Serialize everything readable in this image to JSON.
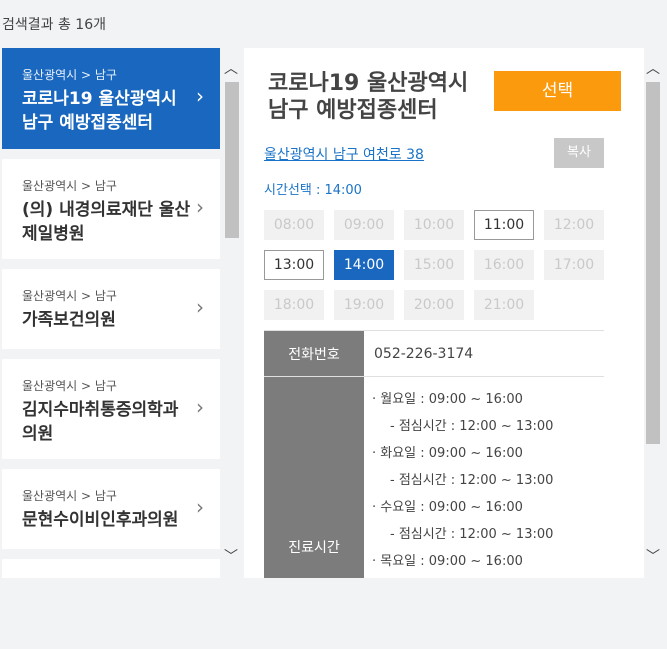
{
  "result_count": "검색결과 총 16개",
  "list": [
    {
      "region": "울산광역시 > 남구",
      "name": "코로나19 울산광역시 남구 예방접종센터",
      "active": true
    },
    {
      "region": "울산광역시 > 남구",
      "name": "(의) 내경의료재단 울산제일병원",
      "active": false
    },
    {
      "region": "울산광역시 > 남구",
      "name": "가족보건의원",
      "active": false
    },
    {
      "region": "울산광역시 > 남구",
      "name": "김지수마취통증의학과의원",
      "active": false
    },
    {
      "region": "울산광역시 > 남구",
      "name": "문현수이비인후과의원",
      "active": false
    }
  ],
  "detail": {
    "title": "코로나19 울산광역시 남구 예방접종센터",
    "select_label": "선택",
    "address": "울산광역시 남구 여천로 38",
    "copy_label": "복사",
    "time_selection": "시간선택 : 14:00",
    "slots": [
      {
        "time": "08:00",
        "state": "disabled"
      },
      {
        "time": "09:00",
        "state": "disabled"
      },
      {
        "time": "10:00",
        "state": "disabled"
      },
      {
        "time": "11:00",
        "state": "available"
      },
      {
        "time": "12:00",
        "state": "disabled"
      },
      {
        "time": "13:00",
        "state": "available"
      },
      {
        "time": "14:00",
        "state": "selected"
      },
      {
        "time": "15:00",
        "state": "disabled"
      },
      {
        "time": "16:00",
        "state": "disabled"
      },
      {
        "time": "17:00",
        "state": "disabled"
      },
      {
        "time": "18:00",
        "state": "disabled"
      },
      {
        "time": "19:00",
        "state": "disabled"
      },
      {
        "time": "20:00",
        "state": "disabled"
      },
      {
        "time": "21:00",
        "state": "disabled"
      }
    ],
    "phone_label": "전화번호",
    "phone": "052-226-3174",
    "hours_label": "진료시간",
    "hours": [
      {
        "text": "· 월요일 : 09:00 ~ 16:00",
        "sub": false
      },
      {
        "text": "- 점심시간 : 12:00 ~ 13:00",
        "sub": true
      },
      {
        "text": "· 화요일 : 09:00 ~ 16:00",
        "sub": false
      },
      {
        "text": "- 점심시간 : 12:00 ~ 13:00",
        "sub": true
      },
      {
        "text": "· 수요일 : 09:00 ~ 16:00",
        "sub": false
      },
      {
        "text": "- 점심시간 : 12:00 ~ 13:00",
        "sub": true
      },
      {
        "text": "· 목요일 : 09:00 ~ 16:00",
        "sub": false
      }
    ]
  },
  "icons": {
    "chevron_right": "›",
    "scroll_up": "︿",
    "scroll_down": "﹀"
  },
  "colors": {
    "accent_blue": "#1967be",
    "select_orange": "#fc9a0e",
    "label_gray": "#7c7c7c"
  }
}
